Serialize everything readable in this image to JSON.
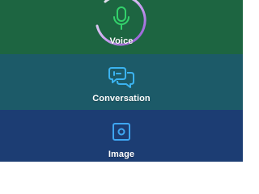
{
  "modes": [
    {
      "id": "voice",
      "label": "Voice",
      "icon": "microphone-icon",
      "color": "#1d6541",
      "icon_color": "#33d16b",
      "active": true
    },
    {
      "id": "conversation",
      "label": "Conversation",
      "icon": "chat-bubbles-icon",
      "color": "#1c5a68",
      "icon_color": "#3bb3f0"
    },
    {
      "id": "image",
      "label": "Image",
      "icon": "camera-icon",
      "color": "#1c3d73",
      "icon_color": "#3ea6f2"
    }
  ],
  "accent_ring": {
    "from": "#ffffff",
    "to": "#9b5fd6"
  }
}
